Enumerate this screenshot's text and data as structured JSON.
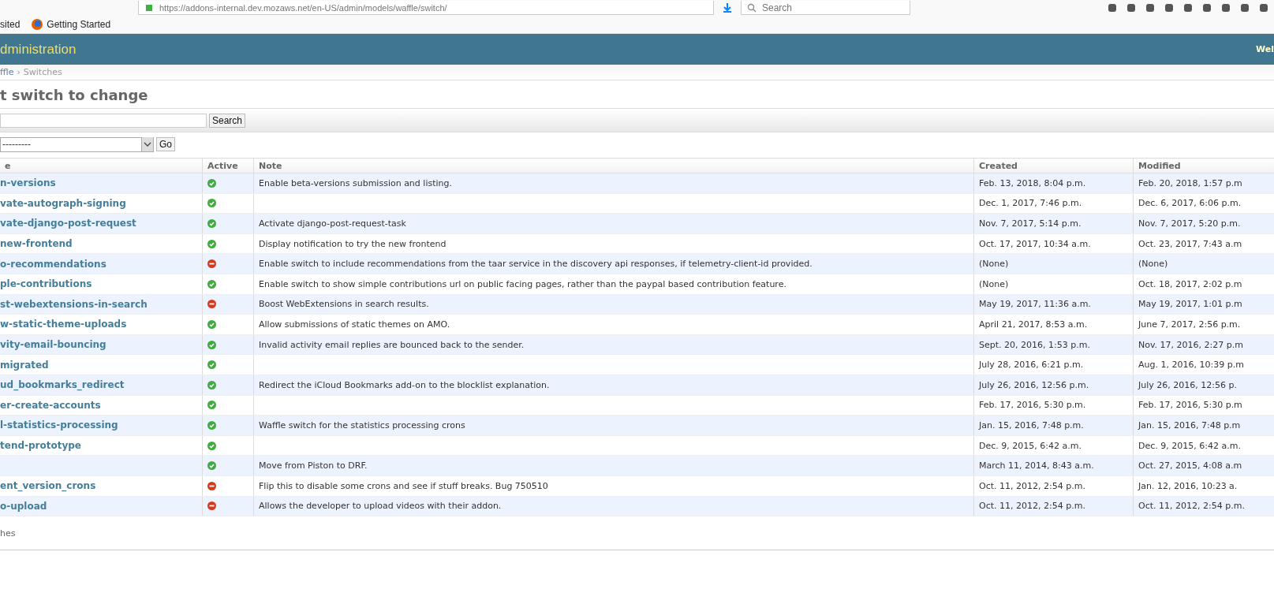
{
  "browser": {
    "url": "https://addons-internal.dev.mozaws.net/en-US/admin/models/waffle/switch/",
    "search_placeholder": "Search",
    "bookmarks": [
      "sited",
      "Getting Started"
    ]
  },
  "header": {
    "title": "dministration",
    "user": "Wel"
  },
  "breadcrumbs": [
    "ffle",
    "›",
    "Switches"
  ],
  "page_title": "t switch to change",
  "search": {
    "button": "Search"
  },
  "actions": {
    "value": "---------",
    "button": "Go"
  },
  "table": {
    "columns": [
      "e",
      "Active",
      "Note",
      "Created",
      "Modified"
    ],
    "rows": [
      {
        "name": "n-versions",
        "active": true,
        "note": "Enable beta-versions submission and listing.",
        "created": "Feb. 13, 2018, 8:04 p.m.",
        "modified": "Feb. 20, 2018, 1:57 p.m"
      },
      {
        "name": "vate-autograph-signing",
        "active": true,
        "created": "Dec. 1, 2017, 7:46 p.m.",
        "modified": "Dec. 6, 2017, 6:06 p.m."
      },
      {
        "name": "vate-django-post-request",
        "active": true,
        "note": "Activate django-post-request-task",
        "created": "Nov. 7, 2017, 5:14 p.m.",
        "modified": "Nov. 7, 2017, 5:20 p.m."
      },
      {
        "name": "new-frontend",
        "active": true,
        "note": "Display notification to try the new frontend",
        "created": "Oct. 17, 2017, 10:34 a.m.",
        "modified": "Oct. 23, 2017, 7:43 a.m"
      },
      {
        "name": "o-recommendations",
        "active": false,
        "note": "Enable switch to include recommendations from the taar service in the discovery api responses, if telemetry-client-id provided.",
        "created": "(None)",
        "modified": "(None)"
      },
      {
        "name": "ple-contributions",
        "active": true,
        "note": "Enable switch to show simple contributions url on public facing pages, rather than the paypal based contribution feature.",
        "created": "(None)",
        "modified": "Oct. 18, 2017, 2:02 p.m"
      },
      {
        "name": "st-webextensions-in-search",
        "active": false,
        "note": "Boost WebExtensions in search results.",
        "created": "May 19, 2017, 11:36 a.m.",
        "modified": "May 19, 2017, 1:01 p.m"
      },
      {
        "name": "w-static-theme-uploads",
        "active": true,
        "note": "Allow submissions of static themes on AMO.",
        "created": "April 21, 2017, 8:53 a.m.",
        "modified": "June 7, 2017, 2:56 p.m."
      },
      {
        "name": "vity-email-bouncing",
        "active": true,
        "note": "Invalid activity email replies are bounced back to the sender.",
        "created": "Sept. 20, 2016, 1:53 p.m.",
        "modified": "Nov. 17, 2016, 2:27 p.m"
      },
      {
        "name": "migrated",
        "active": true,
        "created": "July 28, 2016, 6:21 p.m.",
        "modified": "Aug. 1, 2016, 10:39 p.m"
      },
      {
        "name": "ud_bookmarks_redirect",
        "active": true,
        "note": "Redirect the iCloud Bookmarks add-on to the blocklist explanation.",
        "created": "July 26, 2016, 12:56 p.m.",
        "modified": "July 26, 2016, 12:56 p."
      },
      {
        "name": "er-create-accounts",
        "active": true,
        "created": "Feb. 17, 2016, 5:30 p.m.",
        "modified": "Feb. 17, 2016, 5:30 p.m"
      },
      {
        "name": "l-statistics-processing",
        "active": true,
        "note": "Waffle switch for the statistics processing crons",
        "created": "Jan. 15, 2016, 7:48 p.m.",
        "modified": "Jan. 15, 2016, 7:48 p.m"
      },
      {
        "name": "tend-prototype",
        "active": true,
        "created": "Dec. 9, 2015, 6:42 a.m.",
        "modified": "Dec. 9, 2015, 6:42 a.m."
      },
      {
        "active": true,
        "note": "Move from Piston to DRF.",
        "created": "March 11, 2014, 8:43 a.m.",
        "modified": "Oct. 27, 2015, 4:08 a.m"
      },
      {
        "name": "ent_version_crons",
        "active": false,
        "note": "Flip this to disable some crons and see if stuff breaks. Bug 750510",
        "created": "Oct. 11, 2012, 2:54 p.m.",
        "modified": "Jan. 12, 2016, 10:23 a."
      },
      {
        "name": "o-upload",
        "active": false,
        "note": "Allows the developer to upload videos with their addon.",
        "created": "Oct. 11, 2012, 2:54 p.m.",
        "modified": "Oct. 11, 2012, 2:54 p.m."
      }
    ]
  },
  "footer": "hes"
}
